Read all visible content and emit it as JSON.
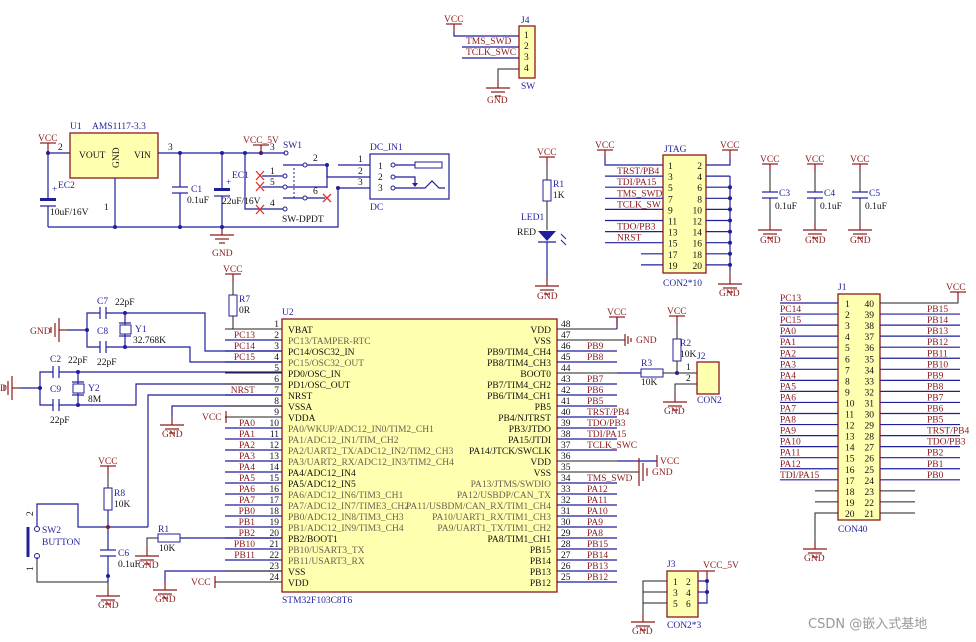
{
  "power": {
    "vcc": "VCC",
    "vcc5": "VCC_5V",
    "gnd": "GND",
    "gnd_left_clip": "D"
  },
  "j4": {
    "ref": "J4",
    "part": "SW",
    "pins": [
      "1",
      "2",
      "3",
      "4"
    ],
    "nets": [
      "TMS_SWD",
      "TCLK_SWC"
    ]
  },
  "u1": {
    "ref": "U1",
    "part": "AMS1117-3.3",
    "vout": "VOUT",
    "gnd": "GND",
    "vin": "VIN",
    "pin_vout": "2",
    "pin_vin": "3",
    "pin_gnd": "1"
  },
  "ec2": {
    "ref": "EC2",
    "value": "10uF/16V",
    "plus": "+"
  },
  "c1": {
    "ref": "C1",
    "value": "0.1uF"
  },
  "ec1": {
    "ref": "EC1",
    "value": "22uF/16V",
    "plus": "+"
  },
  "sw1": {
    "ref": "SW1",
    "part": "SW-DPDT",
    "pins": [
      "3",
      "2",
      "1",
      "5",
      "6",
      "4"
    ]
  },
  "dc": {
    "ref": "DC_IN1",
    "part": "DC",
    "pins": [
      "1",
      "2",
      "3"
    ]
  },
  "led": {
    "r_ref": "R1",
    "r_value": "1K",
    "ref": "LED1",
    "color": "RED"
  },
  "jtag": {
    "ref": "JTAG",
    "part": "CON2*10",
    "rows": [
      [
        "1",
        "2"
      ],
      [
        "3",
        "4"
      ],
      [
        "5",
        "6"
      ],
      [
        "7",
        "8"
      ],
      [
        "9",
        "10"
      ],
      [
        "11",
        "12"
      ],
      [
        "13",
        "14"
      ],
      [
        "15",
        "16"
      ],
      [
        "17",
        "18"
      ],
      [
        "19",
        "20"
      ]
    ],
    "nets": [
      "",
      "TRST/PB4",
      "TDI/PA15",
      "TMS_SWD",
      "TCLK_SW",
      "",
      "TDO/PB3",
      "NRST",
      "",
      ""
    ]
  },
  "decoupling": [
    {
      "ref": "C3",
      "value": "0.1uF"
    },
    {
      "ref": "C4",
      "value": "0.1uF"
    },
    {
      "ref": "C5",
      "value": "0.1uF"
    }
  ],
  "crystals": {
    "c7": "C7",
    "c8": "C8",
    "c2": "C2",
    "c9": "C9",
    "cap_value": "22pF",
    "y1_ref": "Y1",
    "y1_value": "32.768K",
    "y2_ref": "Y2",
    "y2_value": "8M"
  },
  "r7": {
    "ref": "R7",
    "value": "0R"
  },
  "reset": {
    "r_ref": "R8",
    "r_value": "10K",
    "c_ref": "C6",
    "c_value": "0.1uF",
    "sw_ref": "SW2",
    "sw_part": "BUTTON",
    "pin2": "2",
    "pin1": "1"
  },
  "boot1": {
    "r_ref": "R1",
    "r_value": "10K"
  },
  "boot0": {
    "r2_ref": "R2",
    "r2_value": "10K",
    "r3_ref": "R3",
    "r3_value": "10K",
    "j_ref": "J2",
    "j_part": "CON2",
    "pins": [
      "1",
      "2"
    ]
  },
  "u2": {
    "ref": "U2",
    "part": "STM32F103C8T6",
    "left": [
      {
        "num": "1",
        "name": "VBAT",
        "net": "",
        "gray": false
      },
      {
        "num": "2",
        "name": "PC13/TAMPER-RTC",
        "net": "PC13",
        "gray": true
      },
      {
        "num": "3",
        "name": "PC14/OSC32_IN",
        "net": "PC14",
        "gray": false
      },
      {
        "num": "4",
        "name": "PC15/OSC32_OUT",
        "net": "PC15",
        "gray": true
      },
      {
        "num": "5",
        "name": "PD0/OSC_IN",
        "net": "",
        "gray": false
      },
      {
        "num": "6",
        "name": "PD1/OSC_OUT",
        "net": "",
        "gray": false
      },
      {
        "num": "7",
        "name": "NRST",
        "net": "NRST",
        "gray": false
      },
      {
        "num": "8",
        "name": "VSSA",
        "net": "",
        "gray": false
      },
      {
        "num": "9",
        "name": "VDDA",
        "net": "",
        "gray": false
      },
      {
        "num": "10",
        "name": "PA0/WKUP/ADC12_IN0/TIM2_CH1",
        "net": "PA0",
        "gray": true
      },
      {
        "num": "11",
        "name": "PA1/ADC12_IN1/TIM_CH2",
        "net": "PA1",
        "gray": true
      },
      {
        "num": "12",
        "name": "PA2/UART2_TX/ADC12_IN2/TIM2_CH3",
        "net": "PA2",
        "gray": true
      },
      {
        "num": "13",
        "name": "PA3/UART2_RX/ADC12_IN3/TIM2_CH4",
        "net": "PA3",
        "gray": true
      },
      {
        "num": "14",
        "name": "PA4/ADC12_IN4",
        "net": "PA4",
        "gray": false
      },
      {
        "num": "15",
        "name": "PA5/ADC12_IN5",
        "net": "PA5",
        "gray": false
      },
      {
        "num": "16",
        "name": "PA6/ADC12_IN6/TIM3_CH1",
        "net": "PA6",
        "gray": true
      },
      {
        "num": "17",
        "name": "PA7/ADC12_IN7/TIME3_CH2",
        "net": "PA7",
        "gray": true
      },
      {
        "num": "18",
        "name": "PB0/ADC12_IN8/TIM3_CH3",
        "net": "PB0",
        "gray": true
      },
      {
        "num": "19",
        "name": "PB1/ADC12_IN9/TIM3_CH4",
        "net": "PB1",
        "gray": true
      },
      {
        "num": "20",
        "name": "PB2/BOOT1",
        "net": "PB2",
        "gray": false
      },
      {
        "num": "21",
        "name": "PB10/USART3_TX",
        "net": "PB10",
        "gray": true
      },
      {
        "num": "22",
        "name": "PB11/USART3_RX",
        "net": "PB11",
        "gray": true
      },
      {
        "num": "23",
        "name": "VSS",
        "net": "",
        "gray": false
      },
      {
        "num": "24",
        "name": "VDD",
        "net": "",
        "gray": false
      }
    ],
    "right": [
      {
        "num": "48",
        "name": "VDD",
        "net": "",
        "gray": false
      },
      {
        "num": "47",
        "name": "VSS",
        "net": "",
        "gray": false
      },
      {
        "num": "46",
        "name": "PB9/TIM4_CH4",
        "net": "PB9",
        "gray": false
      },
      {
        "num": "45",
        "name": "PB8/TIM4_CH3",
        "net": "PB8",
        "gray": false
      },
      {
        "num": "44",
        "name": "BOOT0",
        "net": "",
        "gray": false
      },
      {
        "num": "43",
        "name": "PB7/TIM4_CH2",
        "net": "PB7",
        "gray": false
      },
      {
        "num": "42",
        "name": "PB6/TIM4_CH1",
        "net": "PB6",
        "gray": false
      },
      {
        "num": "41",
        "name": "PB5",
        "net": "PB5",
        "gray": false
      },
      {
        "num": "40",
        "name": "PB4/NJTRST",
        "net": "TRST/PB4",
        "gray": false
      },
      {
        "num": "39",
        "name": "PB3/JTDO",
        "net": "TDO/PB3",
        "gray": false
      },
      {
        "num": "38",
        "name": "PA15/JTDI",
        "net": "TDI/PA15",
        "gray": false
      },
      {
        "num": "37",
        "name": "PA14/JTCK/SWCLK",
        "net": "TCLK_SWC",
        "gray": false
      },
      {
        "num": "36",
        "name": "VDD",
        "net": "",
        "gray": false
      },
      {
        "num": "35",
        "name": "VSS",
        "net": "",
        "gray": false
      },
      {
        "num": "34",
        "name": "PA13/JTMS/SWDIO",
        "net": "TMS_SWD",
        "gray": true
      },
      {
        "num": "33",
        "name": "PA12/USBDP/CAN_TX",
        "net": "PA12",
        "gray": true
      },
      {
        "num": "32",
        "name": "PA11/USBDM/CAN_RX/TIM1_CH4",
        "net": "PA11",
        "gray": true
      },
      {
        "num": "31",
        "name": "PA10/UART1_RX/TIM1_CH3",
        "net": "PA10",
        "gray": true
      },
      {
        "num": "30",
        "name": "PA9/UART1_TX/TIM1_CH2",
        "net": "PA9",
        "gray": true
      },
      {
        "num": "29",
        "name": "PA8/TIM1_CH1",
        "net": "PA8",
        "gray": false
      },
      {
        "num": "28",
        "name": "PB15",
        "net": "PB15",
        "gray": false
      },
      {
        "num": "27",
        "name": "PB14",
        "net": "PB14",
        "gray": false
      },
      {
        "num": "26",
        "name": "PB13",
        "net": "PB13",
        "gray": false
      },
      {
        "num": "25",
        "name": "PB12",
        "net": "PB12",
        "gray": false
      }
    ]
  },
  "j1": {
    "ref": "J1",
    "part": "CON40",
    "left": [
      {
        "num": "1",
        "net": "PC13"
      },
      {
        "num": "2",
        "net": "PC14"
      },
      {
        "num": "3",
        "net": "PC15"
      },
      {
        "num": "4",
        "net": "PA0"
      },
      {
        "num": "5",
        "net": "PA1"
      },
      {
        "num": "6",
        "net": "PA2"
      },
      {
        "num": "7",
        "net": "PA3"
      },
      {
        "num": "8",
        "net": "PA4"
      },
      {
        "num": "9",
        "net": "PA5"
      },
      {
        "num": "10",
        "net": "PA6"
      },
      {
        "num": "11",
        "net": "PA7"
      },
      {
        "num": "12",
        "net": "PA8"
      },
      {
        "num": "13",
        "net": "PA9"
      },
      {
        "num": "14",
        "net": "PA10"
      },
      {
        "num": "15",
        "net": "PA11"
      },
      {
        "num": "16",
        "net": "PA12"
      },
      {
        "num": "17",
        "net": "TDI/PA15"
      },
      {
        "num": "18",
        "net": ""
      },
      {
        "num": "19",
        "net": ""
      },
      {
        "num": "20",
        "net": ""
      }
    ],
    "right": [
      {
        "num": "40",
        "net": ""
      },
      {
        "num": "39",
        "net": "PB15"
      },
      {
        "num": "38",
        "net": "PB14"
      },
      {
        "num": "37",
        "net": "PB13"
      },
      {
        "num": "36",
        "net": "PB12"
      },
      {
        "num": "35",
        "net": "PB11"
      },
      {
        "num": "34",
        "net": "PB10"
      },
      {
        "num": "33",
        "net": "PB9"
      },
      {
        "num": "32",
        "net": "PB8"
      },
      {
        "num": "31",
        "net": "PB7"
      },
      {
        "num": "30",
        "net": "PB6"
      },
      {
        "num": "29",
        "net": "PB5"
      },
      {
        "num": "28",
        "net": "TRST/PB4"
      },
      {
        "num": "27",
        "net": "TDO/PB3"
      },
      {
        "num": "26",
        "net": "PB2"
      },
      {
        "num": "25",
        "net": "PB1"
      },
      {
        "num": "24",
        "net": "PB0"
      },
      {
        "num": "23",
        "net": ""
      },
      {
        "num": "22",
        "net": ""
      },
      {
        "num": "21",
        "net": ""
      }
    ]
  },
  "j3": {
    "ref": "J3",
    "part": "CON2*3",
    "rows": [
      [
        "1",
        "2"
      ],
      [
        "3",
        "4"
      ],
      [
        "5",
        "6"
      ]
    ]
  },
  "watermark": "CSDN @嵌入式基地"
}
